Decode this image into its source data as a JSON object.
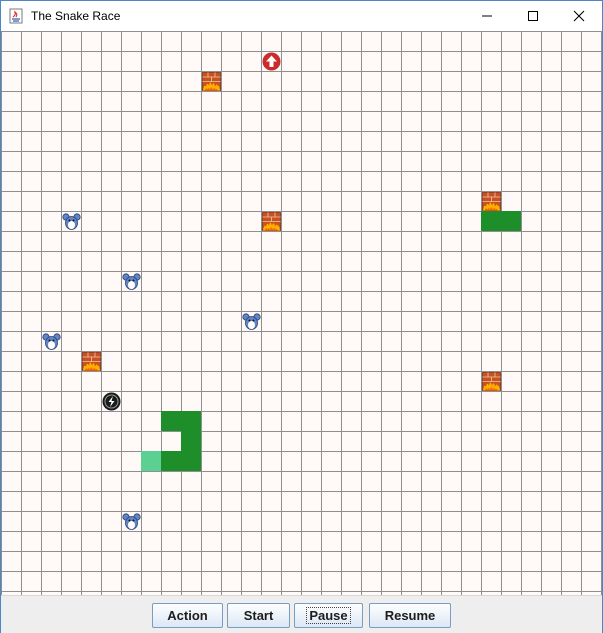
{
  "window": {
    "title": "The Snake Race",
    "controls": [
      "minimize",
      "maximize",
      "close"
    ]
  },
  "board": {
    "cell_size_label": "grid",
    "snakes": [
      {
        "name": "player-snake",
        "color": "#1e8e2a",
        "head_color": "#5ccf93",
        "cells": [
          [
            7,
            21
          ],
          [
            8,
            21
          ],
          [
            9,
            21
          ],
          [
            9,
            20
          ],
          [
            9,
            19
          ],
          [
            8,
            19
          ]
        ],
        "head": [
          7,
          21
        ]
      },
      {
        "name": "enemy-snake",
        "color": "#1e8e2a",
        "cells": [
          [
            24,
            9
          ],
          [
            25,
            9
          ]
        ]
      }
    ],
    "mice": [
      [
        3,
        9
      ],
      [
        6,
        12
      ],
      [
        12,
        14
      ],
      [
        2,
        15
      ],
      [
        6,
        24
      ]
    ],
    "fire_blocks": [
      [
        10,
        2
      ],
      [
        13,
        9
      ],
      [
        24,
        8
      ],
      [
        4,
        16
      ],
      [
        24,
        17
      ]
    ],
    "up_arrow_powerups": [
      [
        13,
        1
      ]
    ],
    "speed_powerups": [
      [
        5,
        18
      ]
    ]
  },
  "buttons": {
    "action": "Action",
    "start": "Start",
    "pause": "Pause",
    "resume": "Resume",
    "focused": "pause"
  },
  "colors": {
    "grid_line": "#8f8f8f",
    "board_bg": "#fff9f7",
    "fire_brick": "#c8511f",
    "fire_flame": "#ffb000",
    "arrow_red": "#cc2b2b",
    "mouse_blue": "#5e86c9"
  }
}
